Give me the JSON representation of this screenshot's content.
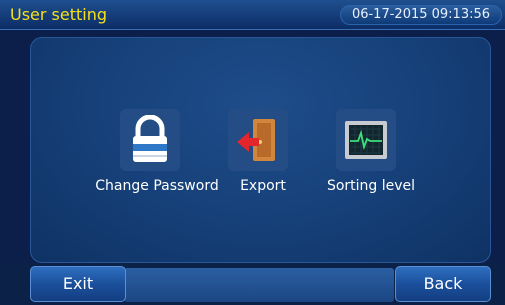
{
  "header": {
    "title": "User setting",
    "datetime": "06-17-2015 09:13:56"
  },
  "main": {
    "items": [
      {
        "label": "Change Password",
        "icon": "lock-icon"
      },
      {
        "label": "Export",
        "icon": "exit-door-icon"
      },
      {
        "label": "Sorting level",
        "icon": "heartbeat-monitor-icon"
      }
    ]
  },
  "footer": {
    "exit_label": "Exit",
    "back_label": "Back"
  },
  "colors": {
    "title": "#f5e01a",
    "background": "#0b1f4a",
    "panel": "#153e76",
    "button": "#1a4f9b"
  }
}
